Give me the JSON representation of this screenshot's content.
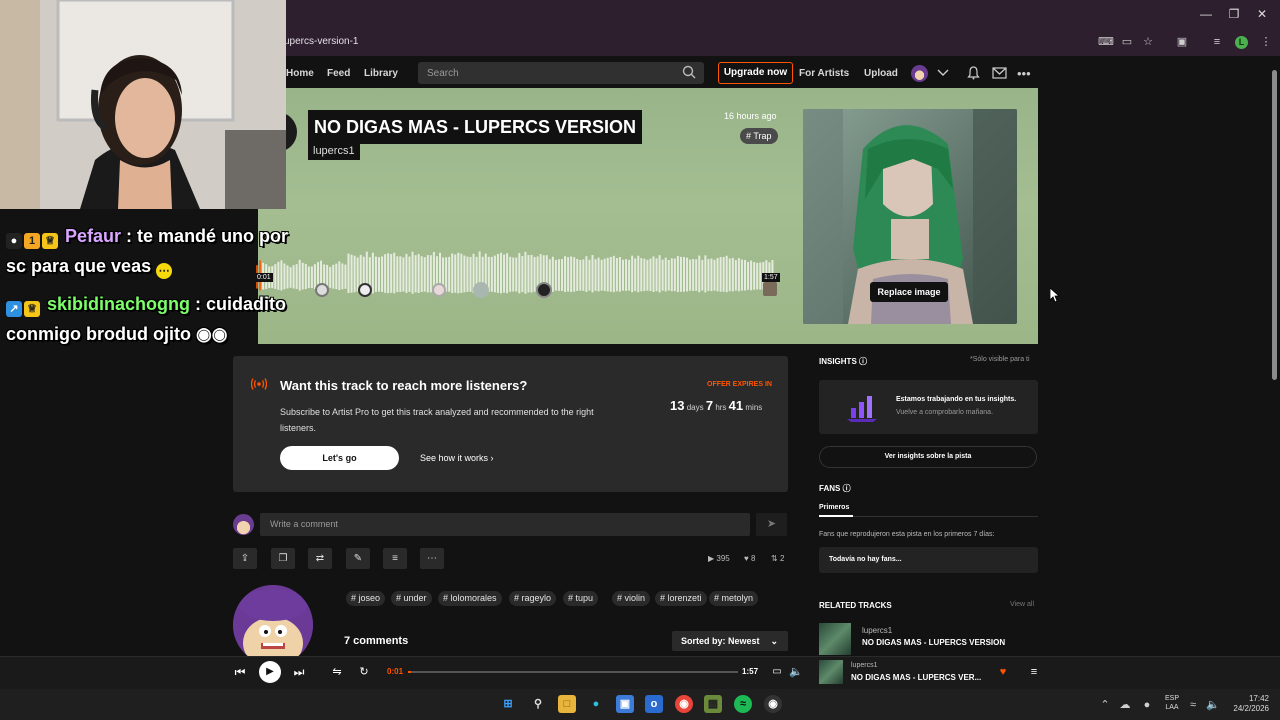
{
  "browser": {
    "url": "upercs-version-1"
  },
  "nav": {
    "home": "Home",
    "feed": "Feed",
    "library": "Library",
    "search_placeholder": "Search",
    "upgrade": "Upgrade now",
    "for_artists": "For Artists",
    "upload": "Upload"
  },
  "track": {
    "title": "NO DIGAS MAS - LUPERCS VERSION",
    "artist": "lupercs1",
    "time_ago": "16 hours ago",
    "genre": "# Trap",
    "time_start": "0:01",
    "time_end": "1:57",
    "replace_image": "Replace image"
  },
  "promo": {
    "title": "Want this track to reach more listeners?",
    "text": "Subscribe to Artist Pro to get this track analyzed and recommended to the right listeners.",
    "offer_label": "OFFER EXPIRES IN",
    "days": "13",
    "days_label": "days",
    "hrs": "7",
    "hrs_label": "hrs",
    "mins": "41",
    "mins_label": "mins",
    "cta": "Let's go",
    "secondary": "See how it works"
  },
  "comment": {
    "placeholder": "Write a comment"
  },
  "stats": {
    "plays": "395",
    "likes": "8",
    "reposts": "2"
  },
  "tags": [
    "# joseo",
    "# under",
    "# lolomorales",
    "# rageylo",
    "# tupu",
    "# violin",
    "# lorenzeti",
    "# metolyn"
  ],
  "comments": {
    "count": "7 comments",
    "sort": "Sorted by: Newest"
  },
  "sidebar": {
    "insights_title": "INSIGHTS",
    "insights_note": "*Sólo visible para ti",
    "insights_working": "Estamos trabajando en tus insights.",
    "insights_back": "Vuelve a comprobarlo mañana.",
    "insights_button": "Ver insights sobre la pista",
    "fans_title": "FANS",
    "fans_tab": "Primeros",
    "fans_desc": "Fans que reprodujeron esta pista en los primeros 7 días:",
    "fans_empty": "Todavía no hay fans...",
    "related_title": "RELATED TRACKS",
    "view_all": "View all",
    "related_artist": "lupercs1",
    "related_track": "NO DIGAS MAS - LUPERCS VERSION"
  },
  "player": {
    "current": "0:01",
    "duration": "1:57",
    "progress": 0.01,
    "artist": "lupercs1",
    "title": "NO DIGAS MAS - LUPERCS VER..."
  },
  "chat": [
    {
      "user": "Pefaur",
      "user_color": "#d9a6ff",
      "text": " : te mandé uno por"
    },
    {
      "text": "sc para que veas"
    },
    {
      "user": "skibidinachogng",
      "user_color": "#7dff6a",
      "text": " : cuidadito"
    },
    {
      "text": "conmigo brodud ojito"
    }
  ],
  "taskbar": {
    "lang_top": "ESP",
    "lang_bottom": "LAA",
    "time": "17:42",
    "date": "24/2/2026"
  },
  "colors": {
    "accent": "#ff5500",
    "hero_bg": "#9ab48a"
  }
}
